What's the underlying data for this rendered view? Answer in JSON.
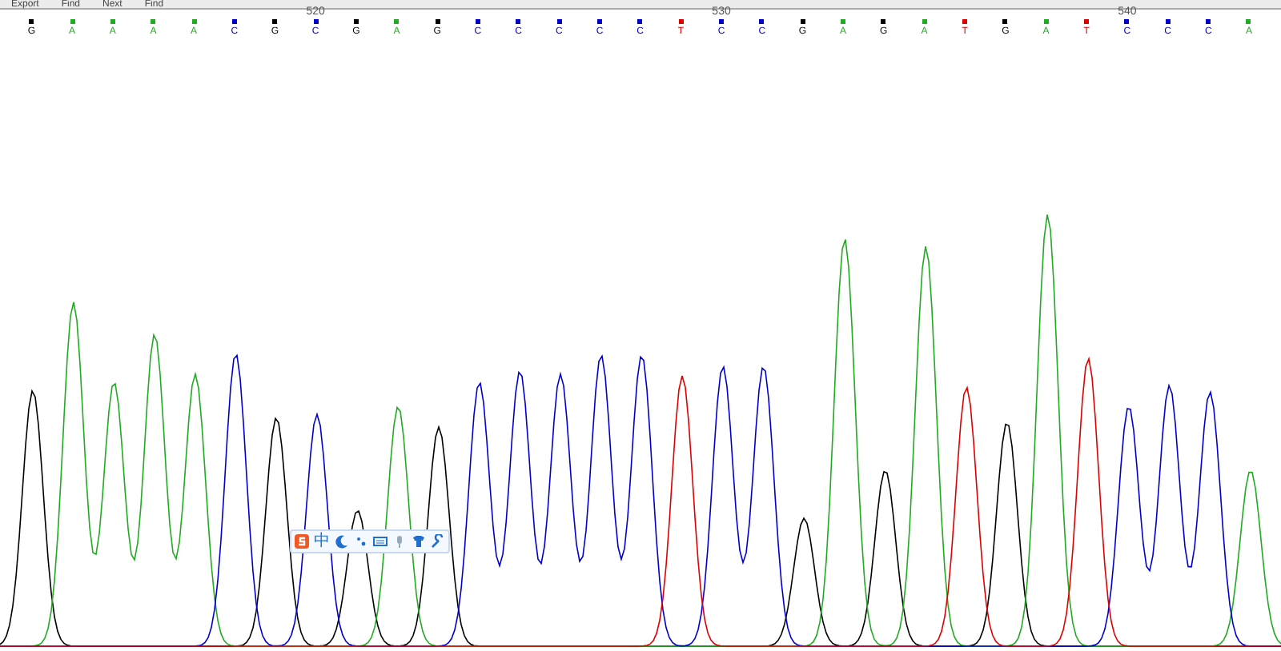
{
  "menu": [
    {
      "label": "Export"
    },
    {
      "label": "Find"
    },
    {
      "label": "Next"
    },
    {
      "label": "Find"
    }
  ],
  "bases": [
    {
      "letter": "G",
      "color": "#000000"
    },
    {
      "letter": "A",
      "color": "#22aa22"
    },
    {
      "letter": "A",
      "color": "#22aa22"
    },
    {
      "letter": "A",
      "color": "#22aa22"
    },
    {
      "letter": "A",
      "color": "#22aa22"
    },
    {
      "letter": "C",
      "color": "#0000cc"
    },
    {
      "letter": "G",
      "color": "#000000"
    },
    {
      "letter": "C",
      "color": "#0000cc",
      "position_label": "520"
    },
    {
      "letter": "G",
      "color": "#000000"
    },
    {
      "letter": "A",
      "color": "#22aa22"
    },
    {
      "letter": "G",
      "color": "#000000"
    },
    {
      "letter": "C",
      "color": "#0000cc"
    },
    {
      "letter": "C",
      "color": "#0000cc"
    },
    {
      "letter": "C",
      "color": "#0000cc"
    },
    {
      "letter": "C",
      "color": "#0000cc"
    },
    {
      "letter": "C",
      "color": "#0000cc"
    },
    {
      "letter": "T",
      "color": "#dd0000"
    },
    {
      "letter": "C",
      "color": "#0000cc",
      "position_label": "530"
    },
    {
      "letter": "C",
      "color": "#0000cc"
    },
    {
      "letter": "G",
      "color": "#000000"
    },
    {
      "letter": "A",
      "color": "#22aa22"
    },
    {
      "letter": "G",
      "color": "#000000"
    },
    {
      "letter": "A",
      "color": "#22aa22"
    },
    {
      "letter": "T",
      "color": "#dd0000"
    },
    {
      "letter": "G",
      "color": "#000000"
    },
    {
      "letter": "A",
      "color": "#22aa22"
    },
    {
      "letter": "T",
      "color": "#dd0000"
    },
    {
      "letter": "C",
      "color": "#0000cc",
      "position_label": "540"
    },
    {
      "letter": "C",
      "color": "#0000cc"
    },
    {
      "letter": "C",
      "color": "#0000cc"
    },
    {
      "letter": "A",
      "color": "#22aa22"
    }
  ],
  "ime_toolbar": {
    "mode": "中"
  }
}
